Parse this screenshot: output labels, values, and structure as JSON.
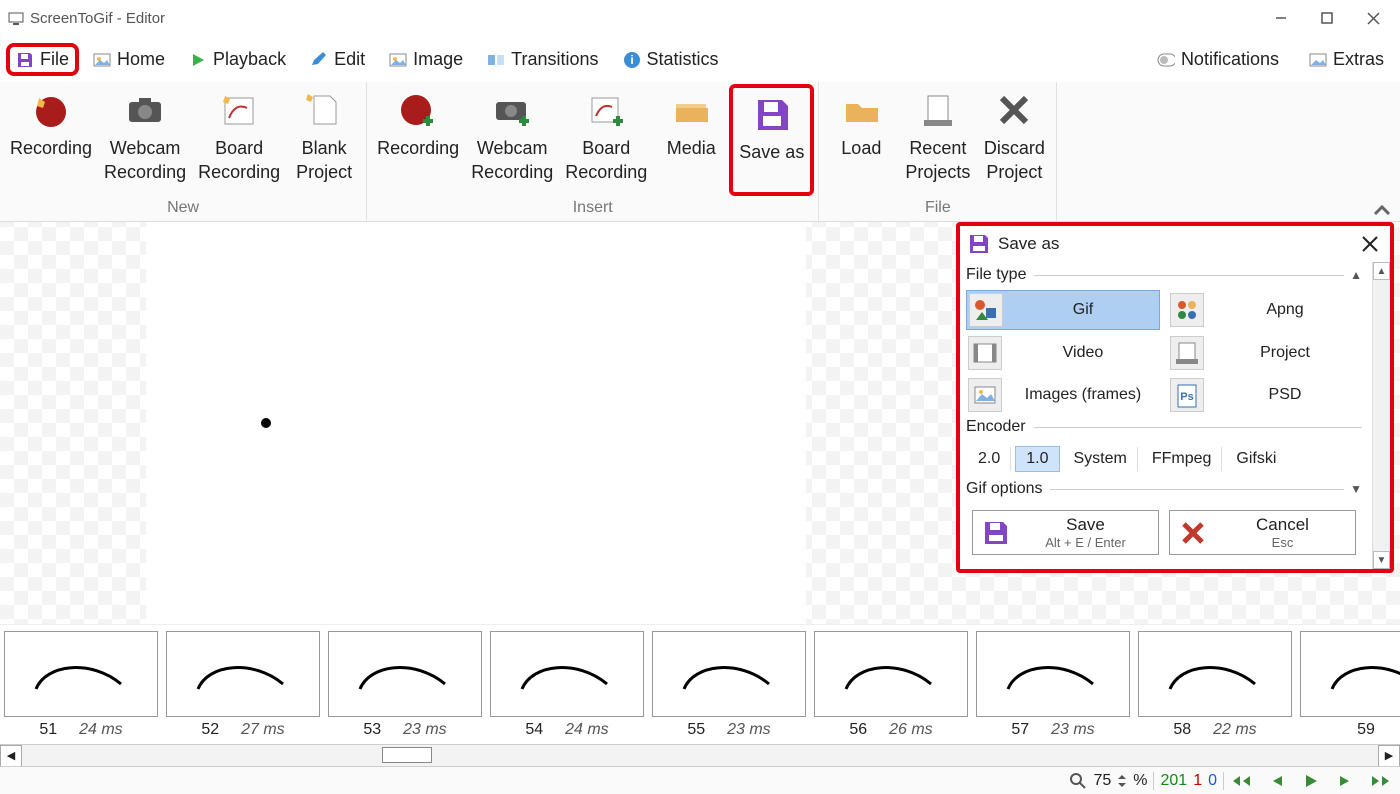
{
  "title": "ScreenToGif - Editor",
  "menu": {
    "file": "File",
    "home": "Home",
    "playback": "Playback",
    "edit": "Edit",
    "image": "Image",
    "transitions": "Transitions",
    "statistics": "Statistics",
    "notifications": "Notifications",
    "extras": "Extras"
  },
  "ribbon": {
    "groups": {
      "new": {
        "label": "New",
        "items": {
          "recording": "Recording",
          "webcam": "Webcam\nRecording",
          "board": "Board\nRecording",
          "blank": "Blank\nProject"
        }
      },
      "insert": {
        "label": "Insert",
        "items": {
          "recording": "Recording",
          "webcam": "Webcam\nRecording",
          "board": "Board\nRecording",
          "media": "Media",
          "saveas": "Save as"
        }
      },
      "file": {
        "label": "File",
        "items": {
          "load": "Load",
          "recent": "Recent\nProjects",
          "discard": "Discard\nProject"
        }
      }
    }
  },
  "save_panel": {
    "title": "Save as",
    "file_type_label": "File type",
    "types": {
      "gif": "Gif",
      "apng": "Apng",
      "video": "Video",
      "project": "Project",
      "images": "Images (frames)",
      "psd": "PSD"
    },
    "encoder_label": "Encoder",
    "encoders": [
      "2.0",
      "1.0",
      "System",
      "FFmpeg",
      "Gifski"
    ],
    "gif_options_label": "Gif options",
    "save": {
      "label": "Save",
      "hint": "Alt + E / Enter"
    },
    "cancel": {
      "label": "Cancel",
      "hint": "Esc"
    }
  },
  "frames": [
    {
      "n": "51",
      "ms": "24 ms"
    },
    {
      "n": "52",
      "ms": "27 ms"
    },
    {
      "n": "53",
      "ms": "23 ms"
    },
    {
      "n": "54",
      "ms": "24 ms"
    },
    {
      "n": "55",
      "ms": "23 ms"
    },
    {
      "n": "56",
      "ms": "26 ms"
    },
    {
      "n": "57",
      "ms": "23 ms"
    },
    {
      "n": "58",
      "ms": "22 ms"
    },
    {
      "n": "59",
      "ms": ""
    }
  ],
  "status": {
    "zoom": "75",
    "pct": "%",
    "green": "201",
    "red": "1",
    "blue": "0"
  }
}
